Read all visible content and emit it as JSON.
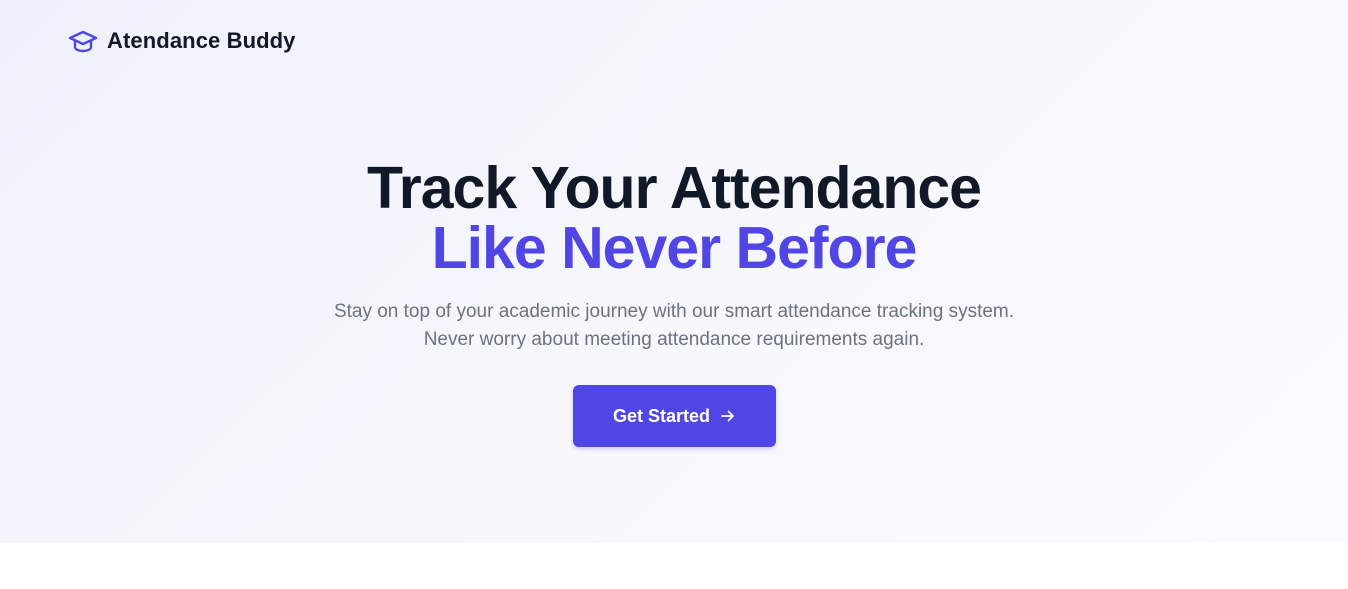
{
  "header": {
    "brand": "Atendance Buddy",
    "logo_icon": "graduation-cap-icon"
  },
  "hero": {
    "title_line1": "Track Your Attendance",
    "title_line2": "Like Never Before",
    "subtitle_line1": "Stay on top of your academic journey with our smart attendance tracking system.",
    "subtitle_line2": "Never worry about meeting attendance requirements again.",
    "cta_label": "Get Started",
    "cta_icon": "arrow-right-icon"
  },
  "colors": {
    "accent": "#4f46e5",
    "heading": "#111827",
    "muted": "#6b7280"
  }
}
